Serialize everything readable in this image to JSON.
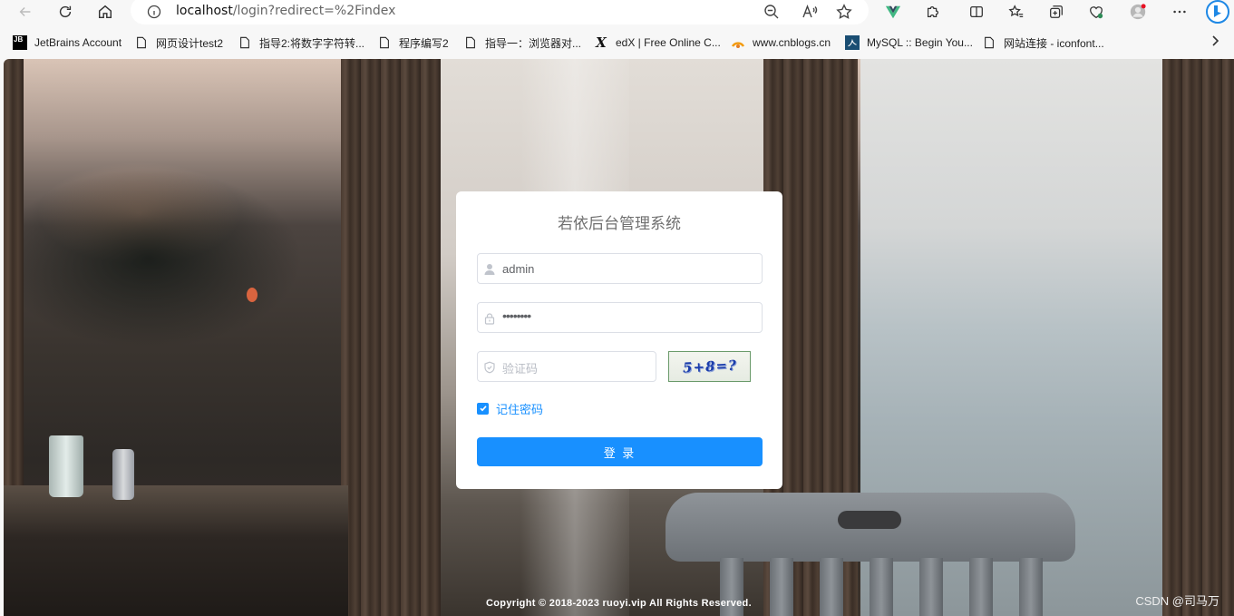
{
  "browser": {
    "url_host": "localhost",
    "url_rest": "/login?redirect=%2Findex",
    "bookmarks": [
      {
        "label": "JetBrains Account",
        "icon": "jetbrains-icon"
      },
      {
        "label": "网页设计test2",
        "icon": "page-icon"
      },
      {
        "label": "指导2:将数字字符转...",
        "icon": "page-icon"
      },
      {
        "label": "程序编写2",
        "icon": "page-icon"
      },
      {
        "label": "指导一：浏览器对...",
        "icon": "page-icon"
      },
      {
        "label": "edX | Free Online C...",
        "icon": "edx-icon"
      },
      {
        "label": "www.cnblogs.cn",
        "icon": "cnblogs-icon"
      },
      {
        "label": "MySQL :: Begin You...",
        "icon": "mysql-icon"
      },
      {
        "label": "网站连接 - iconfont...",
        "icon": "page-icon"
      }
    ],
    "jb_glyph": "JB",
    "edx_glyph": "X"
  },
  "login": {
    "title": "若依后台管理系统",
    "username": "admin",
    "password_mask": "••••••••",
    "code_placeholder": "验证码",
    "captcha_text": "5+8=?",
    "remember_label": "记住密码",
    "remember_checked": true,
    "submit_label": "登 录"
  },
  "footer": {
    "copyright": "Copyright © 2018-2023 ruoyi.vip All Rights Reserved.",
    "watermark": "CSDN @司马万"
  },
  "colors": {
    "primary": "#1890ff",
    "card_bg": "#ffffff",
    "placeholder": "#c0c4cc"
  }
}
